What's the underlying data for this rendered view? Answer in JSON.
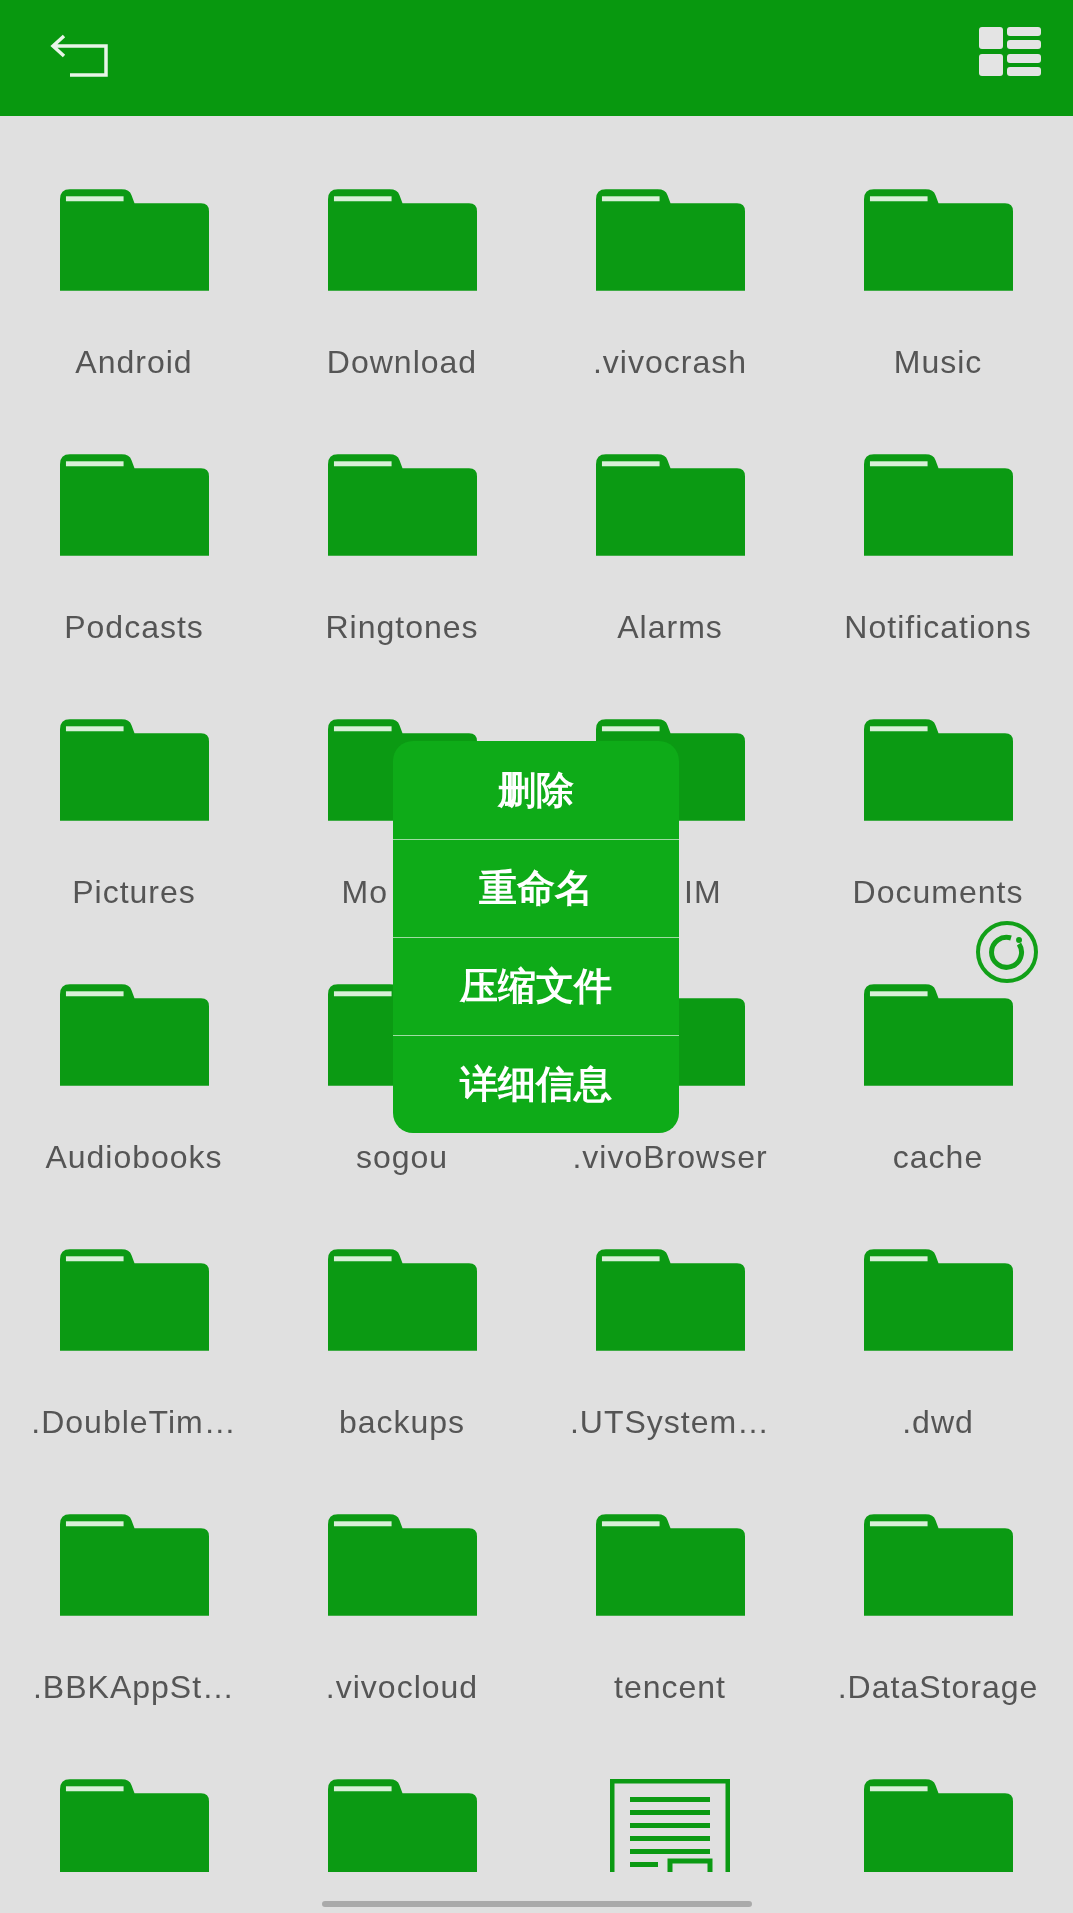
{
  "items": [
    {
      "kind": "folder",
      "label": "Android"
    },
    {
      "kind": "folder",
      "label": "Download"
    },
    {
      "kind": "folder",
      "label": ".vivocrash"
    },
    {
      "kind": "folder",
      "label": "Music"
    },
    {
      "kind": "folder",
      "label": "Podcasts"
    },
    {
      "kind": "folder",
      "label": "Ringtones"
    },
    {
      "kind": "folder",
      "label": "Alarms"
    },
    {
      "kind": "folder",
      "label": "Notifications"
    },
    {
      "kind": "folder",
      "label": "Pictures"
    },
    {
      "kind": "folder",
      "label": "Mo",
      "covered_right": true
    },
    {
      "kind": "folder",
      "label": "IM",
      "covered_left": true
    },
    {
      "kind": "folder",
      "label": "Documents"
    },
    {
      "kind": "folder",
      "label": "Audiobooks"
    },
    {
      "kind": "folder",
      "label": "sogou"
    },
    {
      "kind": "folder",
      "label": ".vivoBrowser"
    },
    {
      "kind": "folder",
      "label": "cache"
    },
    {
      "kind": "folder",
      "label": ".DoubleTim…"
    },
    {
      "kind": "folder",
      "label": "backups"
    },
    {
      "kind": "folder",
      "label": ".UTSystem…"
    },
    {
      "kind": "folder",
      "label": ".dwd"
    },
    {
      "kind": "folder",
      "label": ".BBKAppSt…"
    },
    {
      "kind": "folder",
      "label": ".vivocloud"
    },
    {
      "kind": "folder",
      "label": "tencent"
    },
    {
      "kind": "folder",
      "label": ".DataStorage"
    },
    {
      "kind": "folder"
    },
    {
      "kind": "folder"
    },
    {
      "kind": "document"
    },
    {
      "kind": "folder"
    }
  ],
  "context_menu": [
    "删除",
    "重命名",
    "压缩文件",
    "详细信息"
  ]
}
